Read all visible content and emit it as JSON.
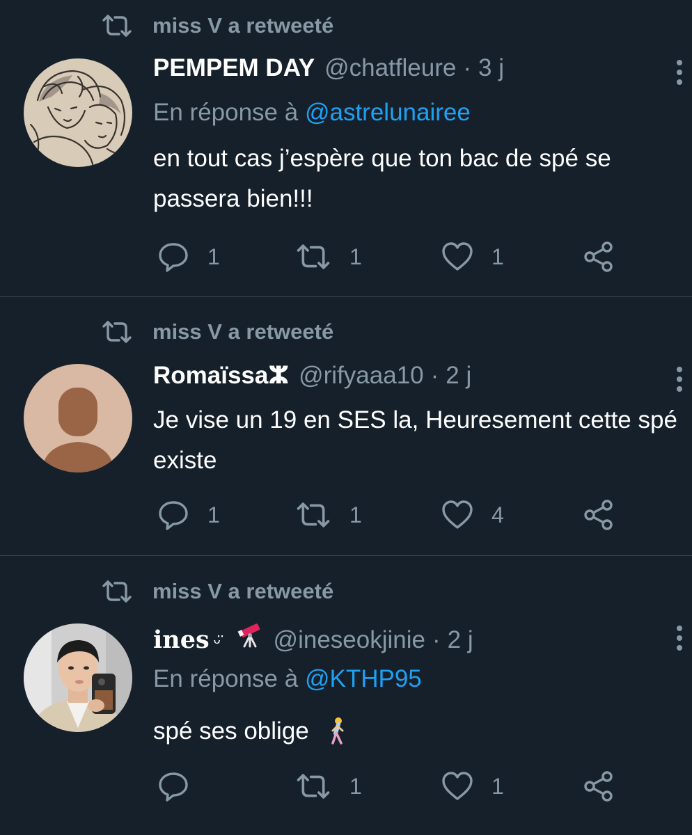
{
  "colors": {
    "background": "#15202b",
    "separator": "#38444d",
    "text_primary": "#ffffff",
    "text_secondary": "#8899a6",
    "link": "#1da1f2"
  },
  "tweets": [
    {
      "retweeted_by": "miss V a retweeté",
      "author_name": "PEMPEM DAY",
      "handle": "@chatfleure",
      "separator": "·",
      "time": "3 j",
      "reply_prefix": "En réponse à",
      "reply_mention": "@astrelunairee",
      "text": "en tout cas j’espère que ton bac de spé se passera bien!!!",
      "counts": {
        "replies": "1",
        "retweets": "1",
        "likes": "1"
      },
      "avatar_icon": "sketch-drawing-avatar"
    },
    {
      "retweeted_by": "miss V a retweeté",
      "author_name": "Romaïssaⵣ",
      "handle": "@rifyaaa10",
      "separator": "·",
      "time": "2 j",
      "text": "Je vise un 19 en SES la, Heuresement cette spé existe",
      "counts": {
        "replies": "1",
        "retweets": "1",
        "likes": "4"
      },
      "avatar_icon": "default-person-avatar"
    },
    {
      "retweeted_by": "miss V a retweeté",
      "author_name": "ines",
      "name_decoration": "ᵕ̈",
      "name_emoji": "telescope-emoji",
      "handle": "@ineseokjinie",
      "separator": "·",
      "time": "2 j",
      "reply_prefix": "En réponse à",
      "reply_mention": "@KTHP95",
      "text": "spé ses oblige",
      "text_emoji": "person-walking-emoji",
      "counts": {
        "replies": "",
        "retweets": "1",
        "likes": "1"
      },
      "avatar_icon": "photo-avatar"
    }
  ]
}
